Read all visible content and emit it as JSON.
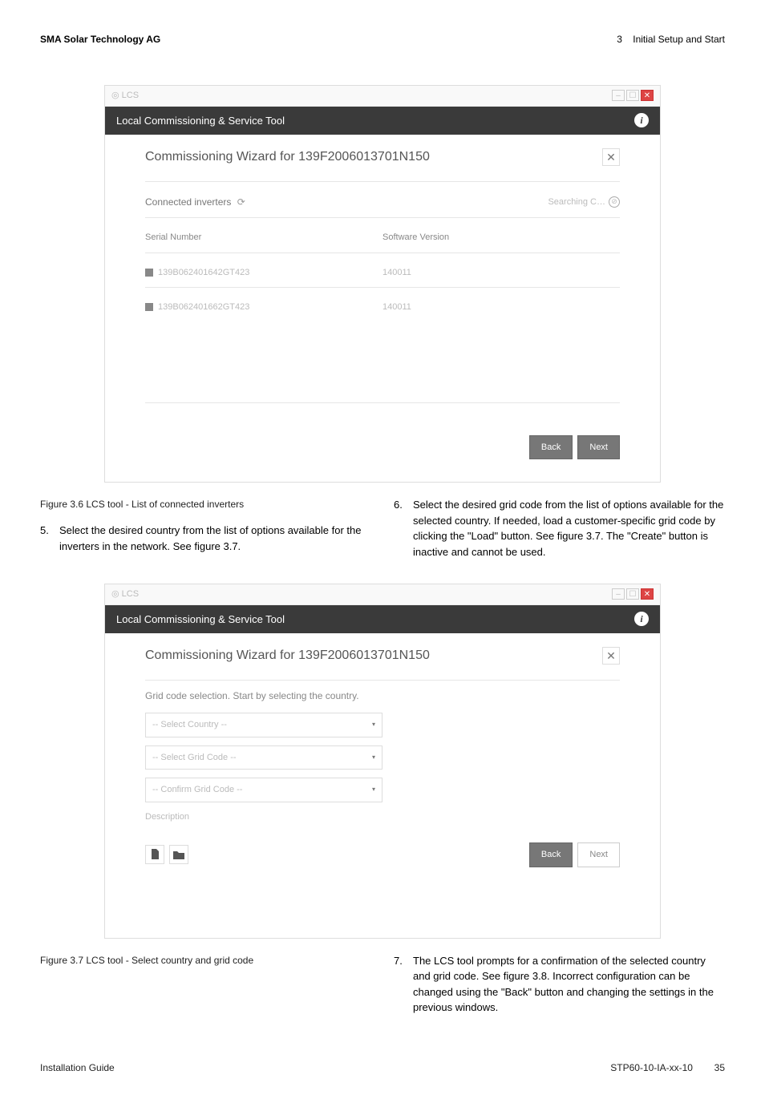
{
  "header": {
    "left": "SMA Solar Technology AG",
    "right_num": "3",
    "right_title": "Initial Setup and Start"
  },
  "win1": {
    "lcs_label": "LCS",
    "dark_bar": "Local Commissioning & Service Tool",
    "wizard_title": "Commissioning Wizard for 139F2006013701N150",
    "connected": "Connected inverters",
    "searching": "Searching C…",
    "col_serial": "Serial Number",
    "col_software": "Software Version",
    "rows": [
      {
        "serial": "139B062401642GT423",
        "ver": "140011"
      },
      {
        "serial": "139B062401662GT423",
        "ver": "140011"
      }
    ],
    "back": "Back",
    "next": "Next"
  },
  "figcap1": "Figure 3.6 LCS tool - List of connected inverters",
  "step5_num": "5.",
  "step5": "Select the desired country from the list of options available for the inverters in the network. See figure 3.7.",
  "step6_num": "6.",
  "step6": "Select the desired grid code from the list of options available for the selected country. If needed, load a customer-specific grid code by clicking the \"Load\" button. See figure 3.7. The \"Create\" button is inactive and cannot be used.",
  "win2": {
    "lcs_label": "LCS",
    "dark_bar": "Local Commissioning & Service Tool",
    "wizard_title": "Commissioning Wizard for 139F2006013701N150",
    "grid_sel_text": "Grid code selection. Start by selecting the country.",
    "select_country": "-- Select Country --",
    "select_grid": "-- Select Grid Code --",
    "confirm_grid": "-- Confirm Grid Code --",
    "desc": "Description",
    "back": "Back",
    "next": "Next"
  },
  "figcap2": "Figure 3.7 LCS tool - Select country and grid code",
  "step7_num": "7.",
  "step7": "The LCS tool prompts for a confirmation of the selected country and grid code. See figure 3.8. Incorrect configuration can be changed using the \"Back\" button and changing the settings in the previous windows.",
  "footer": {
    "left": "Installation Guide",
    "mid": "STP60-10-IA-xx-10",
    "right": "35"
  }
}
